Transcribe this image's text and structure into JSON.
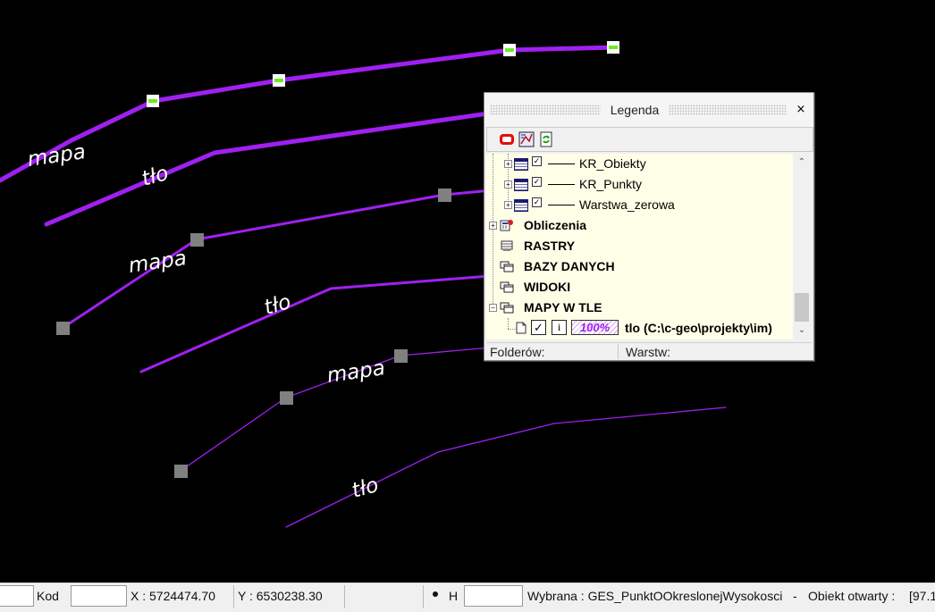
{
  "map": {
    "labels": [
      "mapa",
      "tło",
      "mapa",
      "tło",
      "mapa",
      "tło"
    ],
    "colors": {
      "line": "#a020f0",
      "node": "#808080",
      "highlight": "#66ee22",
      "background": "#000000"
    }
  },
  "legend": {
    "title": "Legenda",
    "close_glyph": "×",
    "toolbar_icons": [
      "layers-icon",
      "map-tools-icon",
      "refresh-icon"
    ],
    "items": [
      {
        "label": "KR_Obiekty",
        "checked": true
      },
      {
        "label": "KR_Punkty",
        "checked": true
      },
      {
        "label": "Warstwa_zerowa",
        "checked": true
      },
      {
        "label": "Obliczenia"
      },
      {
        "label": "RASTRY"
      },
      {
        "label": "BAZY DANYCH"
      },
      {
        "label": "WIDOKI"
      },
      {
        "label": "MAPY W TLE"
      },
      {
        "label": "tlo (C:\\c-geo\\projekty\\im)",
        "opacity": "100%",
        "info": "i"
      }
    ],
    "status": {
      "folders_label": "Folderów:",
      "layers_label": "Warstw:"
    }
  },
  "statusbar": {
    "kod_label": "Kod",
    "kod_value": "",
    "x_readout": "X : 5724474.70",
    "y_readout": "Y : 6530238.30",
    "h_label": "H",
    "h_value": "",
    "selected": "Wybrana : GES_PunktOOkreslonejWysokosci",
    "separator": "-",
    "object_open": "Obiekt otwarty :",
    "object_value": "[97.1"
  }
}
